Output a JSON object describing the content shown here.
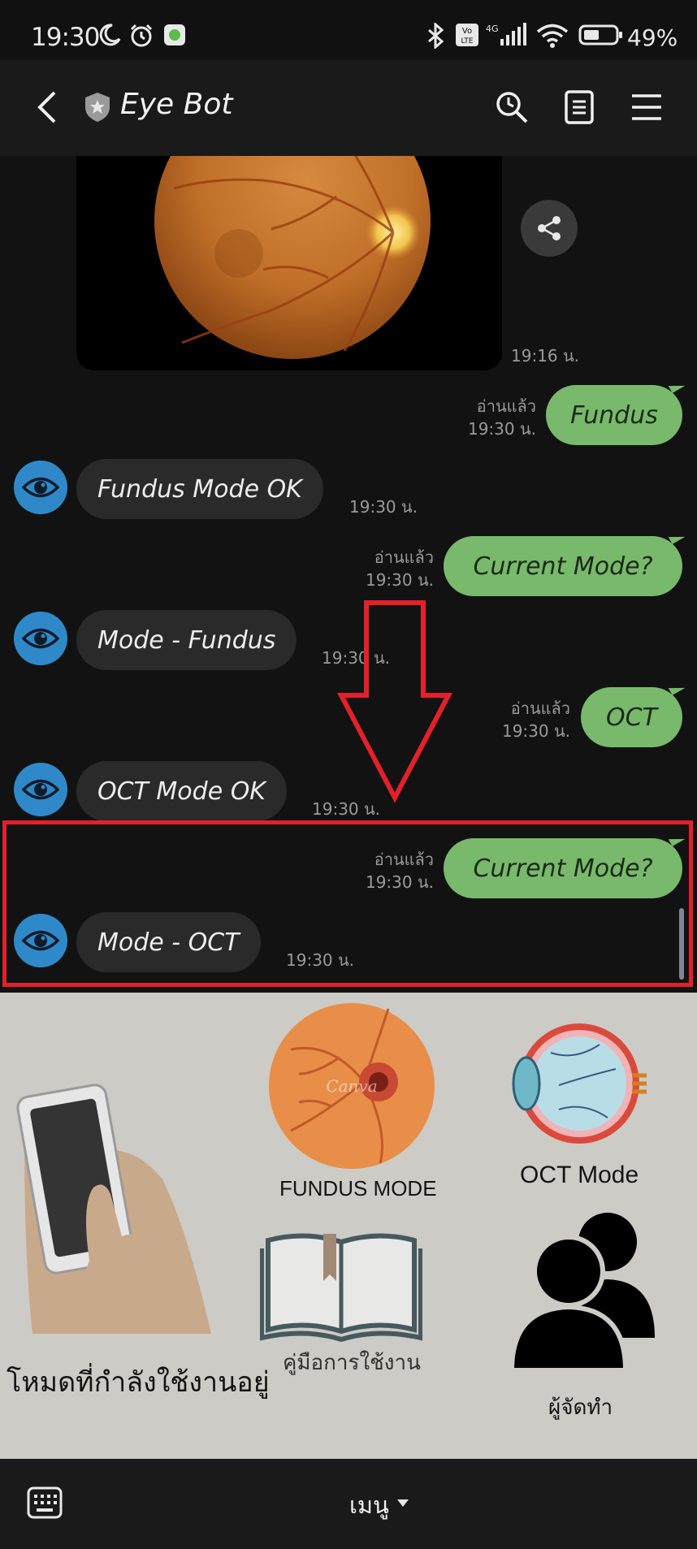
{
  "status_bar": {
    "time": "19:30",
    "battery_percent": "49%"
  },
  "header": {
    "title": "Eye Bot"
  },
  "messages": [
    {
      "type": "image",
      "time": "19:16 น."
    },
    {
      "type": "out",
      "text": "Fundus",
      "read": "อ่านแล้ว",
      "time": "19:30 น."
    },
    {
      "type": "in",
      "text": "Fundus Mode OK",
      "time": "19:30 น."
    },
    {
      "type": "out",
      "text": "Current Mode?",
      "read": "อ่านแล้ว",
      "time": "19:30 น."
    },
    {
      "type": "in",
      "text": "Mode - Fundus",
      "time": "19:30 น."
    },
    {
      "type": "out",
      "text": "OCT",
      "read": "อ่านแล้ว",
      "time": "19:30 น."
    },
    {
      "type": "in",
      "text": "OCT Mode OK",
      "time": "19:30 น."
    },
    {
      "type": "out",
      "text": "Current Mode?",
      "read": "อ่านแล้ว",
      "time": "19:30 น."
    },
    {
      "type": "in",
      "text": "Mode - OCT",
      "time": "19:30 น."
    }
  ],
  "rich_menu": {
    "current_mode_label": "โหมดที่กำลังใช้งานอยู่",
    "fundus_label": "FUNDUS MODE",
    "fundus_watermark": "Canva",
    "oct_label": "OCT Mode",
    "manual_label": "คู่มือการใช้งาน",
    "creators_label": "ผู้จัดทำ"
  },
  "bottom_bar": {
    "menu_label": "เมนู"
  },
  "colors": {
    "outgoing_bubble": "#79b96c",
    "incoming_bubble": "#2a2a2a",
    "avatar": "#2f89c9",
    "highlight": "#e4202a",
    "menu_background": "#cdcbc6"
  }
}
